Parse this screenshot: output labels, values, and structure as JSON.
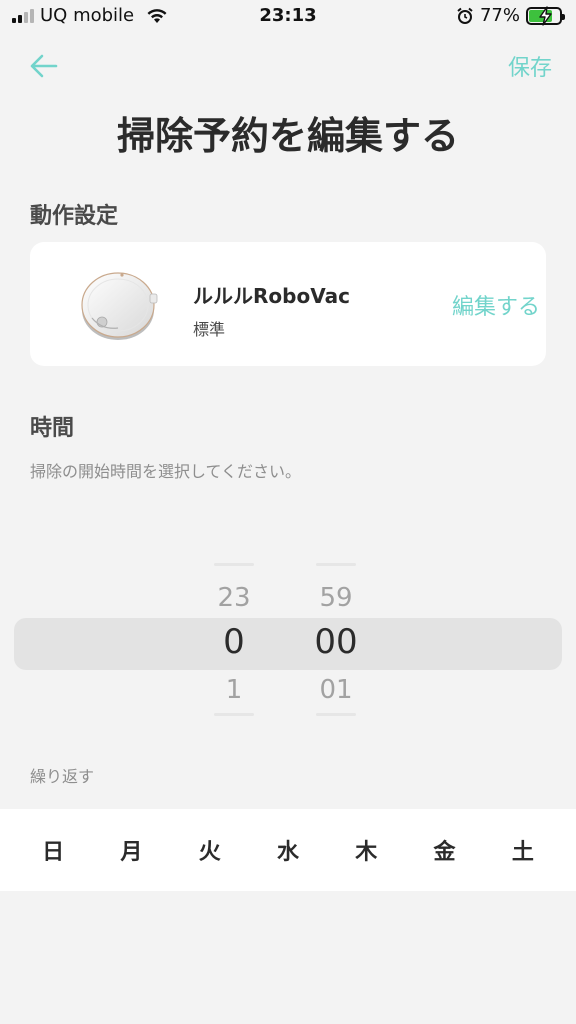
{
  "status_bar": {
    "carrier": "UQ mobile",
    "time": "23:13",
    "battery_percent": "77%",
    "battery_level": 0.77,
    "icons": [
      "signal-icon",
      "wifi-icon",
      "alarm-icon",
      "battery-charging-icon"
    ]
  },
  "nav": {
    "back_icon": "back-arrow-icon",
    "save_label": "保存",
    "accent_color": "#72d4cb"
  },
  "page": {
    "title": "掃除予約を編集する"
  },
  "action_settings": {
    "label": "動作設定",
    "device": {
      "name": "ルルルRoboVac",
      "mode": "標準",
      "edit_label": "編集する",
      "image_icon": "robot-vacuum-icon"
    }
  },
  "time_section": {
    "label": "時間",
    "hint": "掃除の開始時間を選択してください。",
    "hour_picker": {
      "prev": "23",
      "selected": "0",
      "next": "1"
    },
    "minute_picker": {
      "prev": "59",
      "selected": "00",
      "next": "01"
    }
  },
  "repeat_section": {
    "label": "繰り返す",
    "days": [
      "日",
      "月",
      "火",
      "水",
      "木",
      "金",
      "土"
    ]
  }
}
